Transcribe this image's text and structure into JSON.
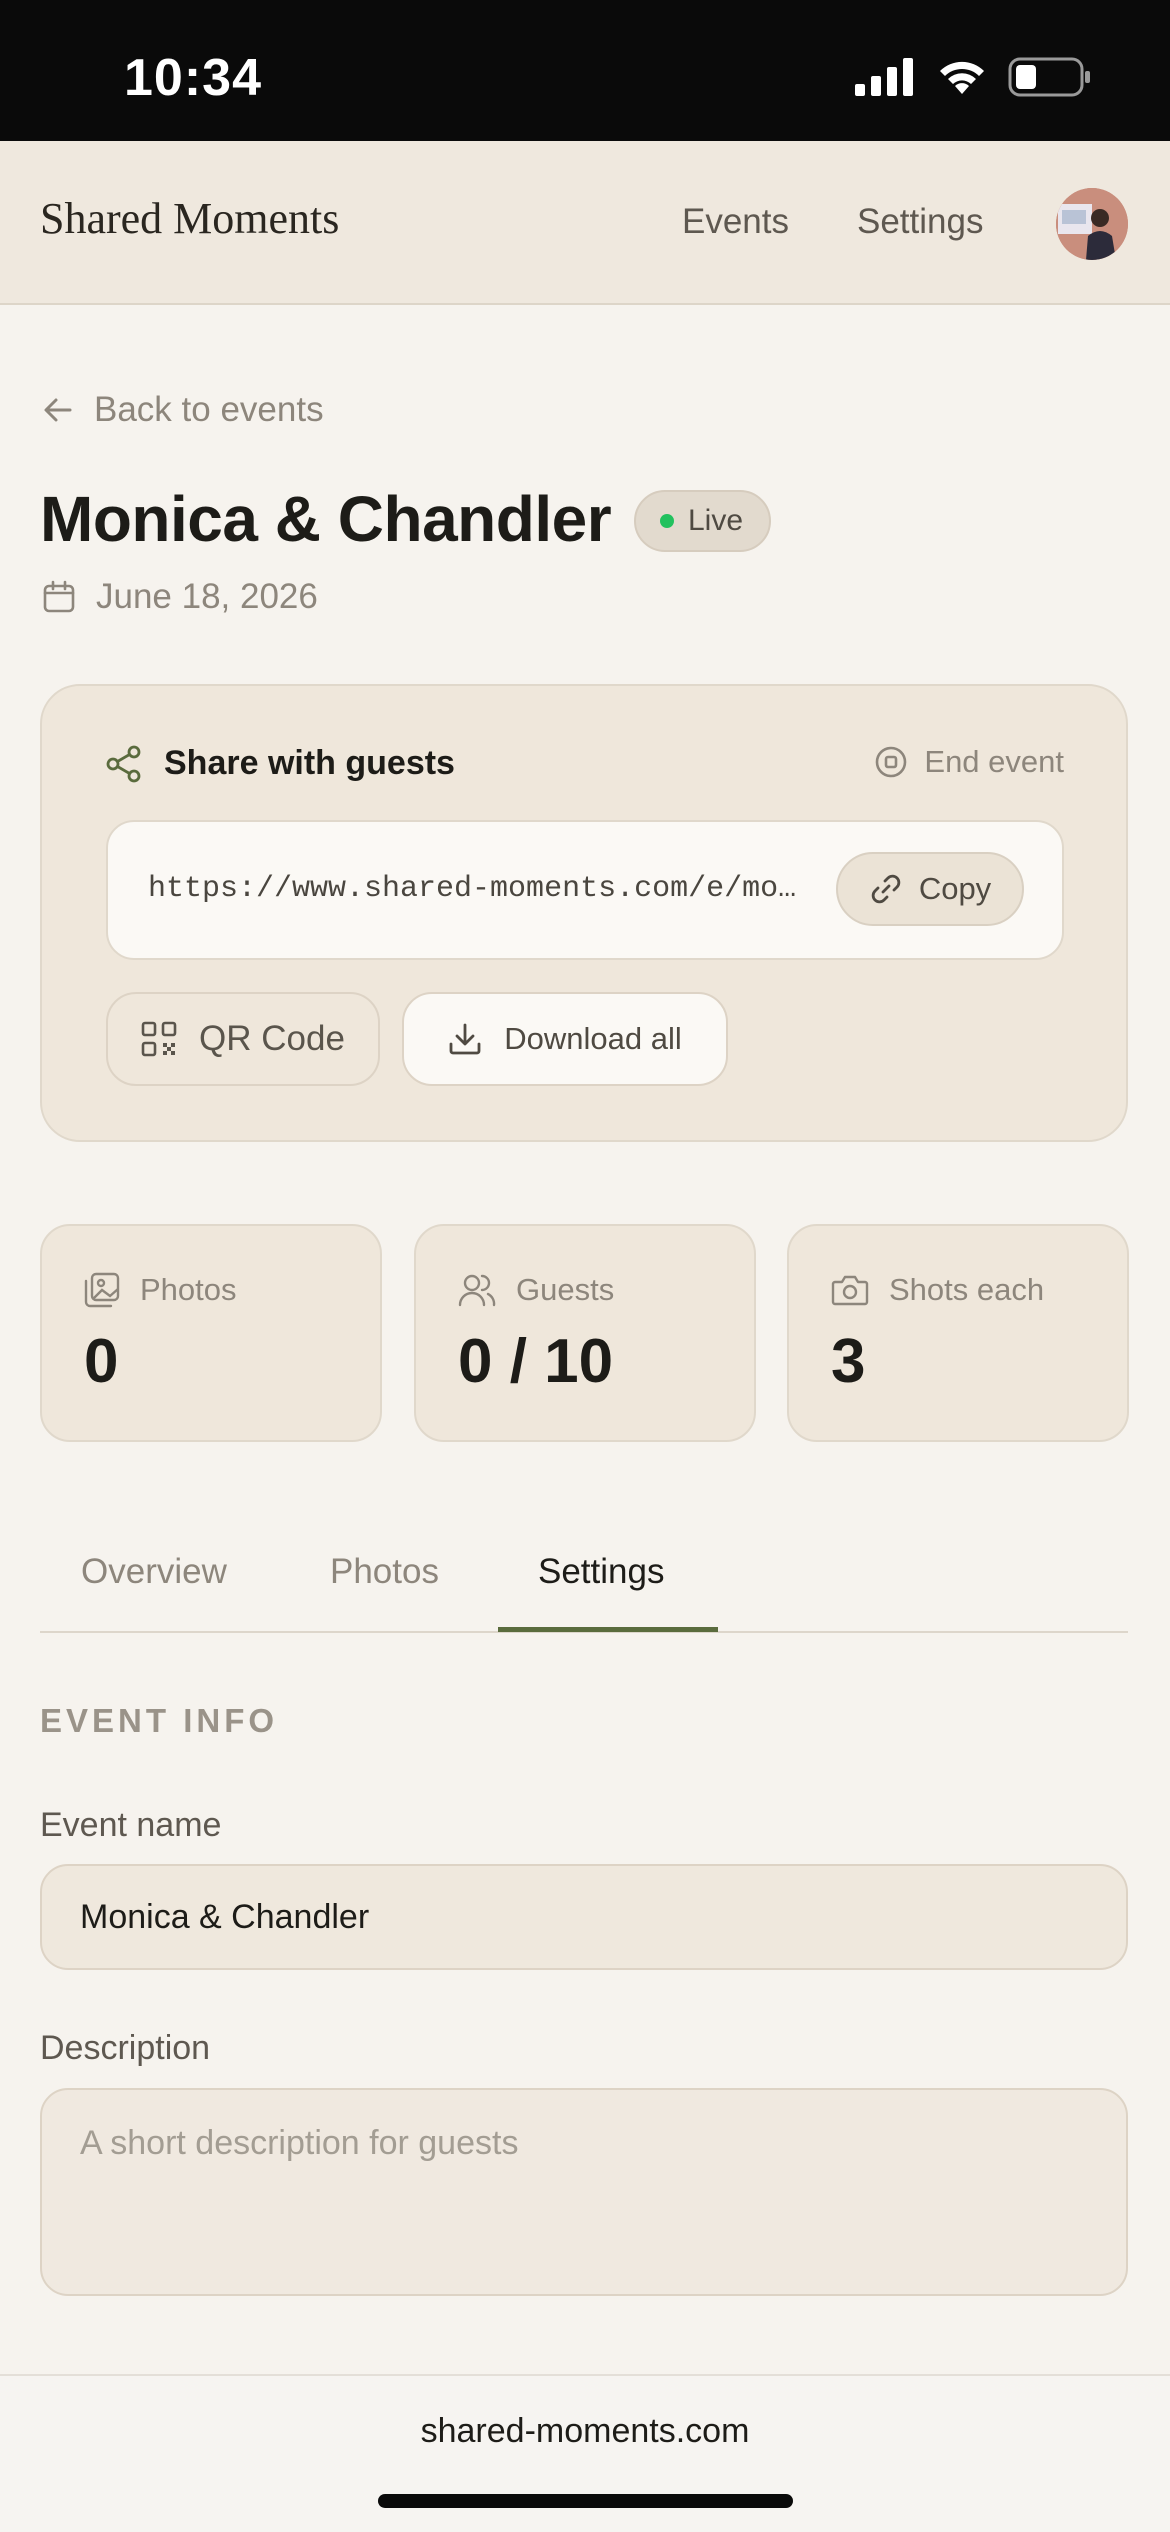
{
  "status_bar": {
    "time": "10:34"
  },
  "header": {
    "brand": "Shared Moments",
    "nav": {
      "events": "Events",
      "settings": "Settings"
    }
  },
  "back_link": "Back to events",
  "event": {
    "title": "Monica & Chandler",
    "status": "Live",
    "date": "June 18, 2026"
  },
  "share": {
    "heading": "Share with guests",
    "end_event": "End event",
    "url": "https://www.shared-moments.com/e/mo…",
    "copy": "Copy",
    "qr_code": "QR Code",
    "download_all": "Download all"
  },
  "stats": [
    {
      "label": "Photos",
      "value": "0"
    },
    {
      "label": "Guests",
      "value": "0 / 10"
    },
    {
      "label": "Shots each",
      "value": "3"
    }
  ],
  "tabs": {
    "overview": "Overview",
    "photos": "Photos",
    "settings": "Settings",
    "active": "Settings"
  },
  "settings_form": {
    "section_title": "EVENT INFO",
    "event_name_label": "Event name",
    "event_name_value": "Monica & Chandler",
    "description_label": "Description",
    "description_placeholder": "A short description for guests"
  },
  "browser": {
    "domain": "shared-moments.com"
  },
  "colors": {
    "accent": "#5a6b3d",
    "live_dot": "#22c15e",
    "card_bg": "#efe7db",
    "page_bg": "#f6f3ee"
  }
}
